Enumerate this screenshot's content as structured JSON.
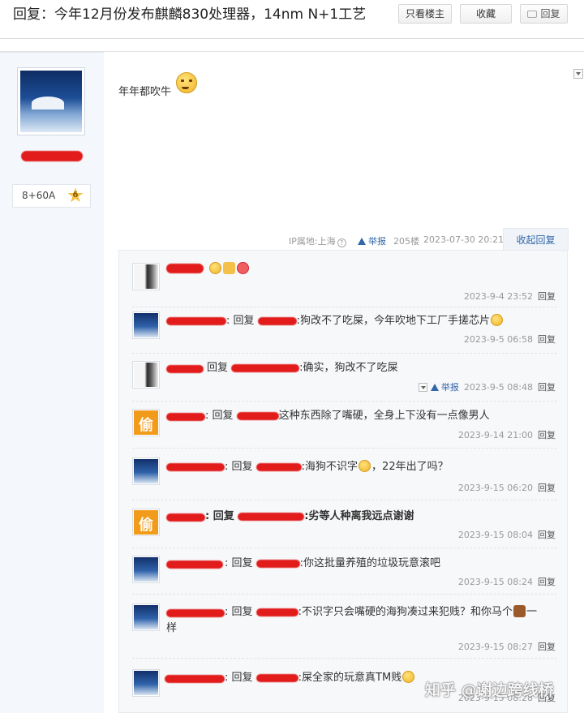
{
  "header": {
    "title": "回复：今年12月份发布麒麟830处理器，14nm N+1工艺",
    "only_host_label": "只看楼主",
    "favorite_label": "收藏",
    "reply_label": "回复"
  },
  "author": {
    "level_text": "8+60A",
    "level_badge": "6"
  },
  "post": {
    "text": "年年都吹牛",
    "ip_label": "IP属地:上海",
    "ip_help": "?",
    "report_label": "举报",
    "floor": "205楼",
    "time": "2023-07-30 20:21",
    "collapse_label": "收起回复"
  },
  "replies": [
    {
      "avatar": "girl",
      "reply_word": "",
      "text": "",
      "time": "2023-9-4 23:52",
      "action": "回复"
    },
    {
      "avatar": "snow",
      "reply_word": ": 回复",
      "text": ":狗改不了吃屎，今年吹地下工厂手搓芯片",
      "time": "2023-9-5 06:58",
      "action": "回复"
    },
    {
      "avatar": "girl",
      "reply_word": "回复",
      "text": ":确实，狗改不了吃屎",
      "time": "2023-9-5 08:48",
      "action": "回复",
      "report": "举报"
    },
    {
      "avatar": "orange",
      "reply_word": ": 回复",
      "text": "这种东西除了嘴硬，全身上下没有一点像男人",
      "time": "2023-9-14 21:00",
      "action": "回复"
    },
    {
      "avatar": "snow",
      "reply_word": ": 回复",
      "text": ":海狗不识字",
      "text2": "，22年出了吗？",
      "time": "2023-9-15 06:20",
      "action": "回复"
    },
    {
      "avatar": "orange",
      "reply_word": ": 回复",
      "text": ":劣等人种离我远点谢谢",
      "time": "2023-9-15 08:04",
      "action": "回复"
    },
    {
      "avatar": "snow",
      "reply_word": ": 回复",
      "text": ":你这批量养殖的垃圾玩意滚吧",
      "time": "2023-9-15 08:24",
      "action": "回复"
    },
    {
      "avatar": "snow",
      "reply_word": ": 回复",
      "text": ":不识字只会嘴硬的海狗凑过来犯贱？和你马个",
      "text2": "一",
      "text3": "样",
      "time": "2023-9-15 08:27",
      "action": "回复"
    },
    {
      "avatar": "snow",
      "reply_word": ": 回复",
      "text": ":屎全家的玩意真TM贱",
      "time": "2023-9-15 08:28",
      "action": "回复"
    }
  ],
  "watermark": "知乎 @谢边跨线桥",
  "colors": {
    "link": "#3366aa",
    "redaction": "#e21b1b",
    "panel": "#f7f8fa"
  }
}
